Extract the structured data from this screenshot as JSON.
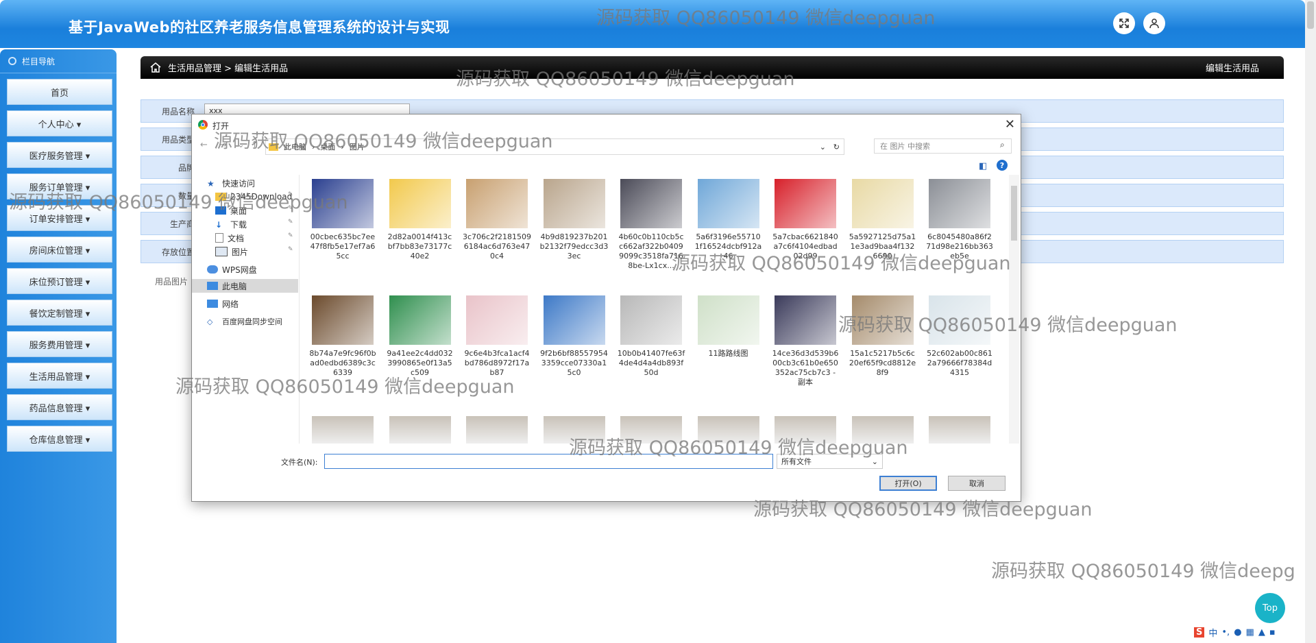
{
  "header": {
    "title": "基于JavaWeb的社区养老服务信息管理系统的设计与实现"
  },
  "sidebar": {
    "nav_title": "栏目导航",
    "items": [
      {
        "label": "首页"
      },
      {
        "label": "个人中心 ▾"
      },
      {
        "label": "医疗服务管理 ▾"
      },
      {
        "label": "服务订单管理 ▾"
      },
      {
        "label": "订单安排管理 ▾"
      },
      {
        "label": "房间床位管理 ▾"
      },
      {
        "label": "床位预订管理 ▾"
      },
      {
        "label": "餐饮定制管理 ▾"
      },
      {
        "label": "服务费用管理 ▾"
      },
      {
        "label": "生活用品管理 ▾"
      },
      {
        "label": "药品信息管理 ▾"
      },
      {
        "label": "仓库信息管理 ▾"
      }
    ]
  },
  "breadcrumb": {
    "path": "生活用品管理 > 编辑生活用品",
    "right": "编辑生活用品"
  },
  "form": {
    "rows": [
      {
        "label": "用品名称",
        "value": "xxx"
      },
      {
        "label": "用品类型",
        "value": ""
      },
      {
        "label": "品牌",
        "value": ""
      },
      {
        "label": "数量",
        "value": ""
      },
      {
        "label": "生产商",
        "value": ""
      },
      {
        "label": "存放位置",
        "value": ""
      }
    ],
    "picture_label": "用品图片"
  },
  "dialog": {
    "title": "打开",
    "address": [
      "此电脑",
      "桌面",
      "图片"
    ],
    "search_placeholder": "在 图片 中搜索",
    "nav": [
      {
        "label": "快速访问"
      },
      {
        "label": "2345Download"
      },
      {
        "label": "桌面"
      },
      {
        "label": "下载"
      },
      {
        "label": "文档"
      },
      {
        "label": "图片"
      },
      {
        "label": "WPS网盘"
      },
      {
        "label": "此电脑"
      },
      {
        "label": "网络"
      },
      {
        "label": "百度网盘同步空间"
      }
    ],
    "files": [
      {
        "name": "00cbec635bc7ee47f8fb5e17ef7a65cc",
        "color": "#2a3f8f"
      },
      {
        "name": "2d82a0014f413cbf7bb83e73177c40e2",
        "color": "#f2c94c"
      },
      {
        "name": "3c706c2f21815096184ac6d763e470c4",
        "color": "#c8a070"
      },
      {
        "name": "4b9d819237b201b2132f79edcc3d33ec",
        "color": "#b9a58c"
      },
      {
        "name": "4b60c0b110cb5cc662af322b04099099c3518fa7168be-Lx1cx...",
        "color": "#4b4b58"
      },
      {
        "name": "5a6f3196e557101f16524dcbf912a46",
        "color": "#6fa7d8"
      },
      {
        "name": "5a7cbac6621840a7c6f4104edbad02d99",
        "color": "#d7202a"
      },
      {
        "name": "5a5927125d75a11e3ad9baa4f1326690",
        "color": "#e8d9a4"
      },
      {
        "name": "6c8045480a86f271d98e216bb363eb5e",
        "color": "#8b8f96"
      },
      {
        "name": "8b74a7e9fc96f0bad0edbd6389c3c6339",
        "color": "#6b4a2c"
      },
      {
        "name": "9a41ee2c4dd0323990865e0f13a5c509",
        "color": "#2f8f4e"
      },
      {
        "name": "9c6e4b3fca1acf4bd786d8972f17ab87",
        "color": "#e9c3c9"
      },
      {
        "name": "9f2b6bf885579543359cce07330a15c0",
        "color": "#3d79c7"
      },
      {
        "name": "10b0b41407fe63f4de4d4a4db893f50d",
        "color": "#b8b8b8"
      },
      {
        "name": "11路路线图",
        "color": "#cfe0c8"
      },
      {
        "name": "14ce36d3d539b600cb3c61b0e650352ac75cb7c3 - 副本",
        "color": "#3a3a5a"
      },
      {
        "name": "15a1c5217b5c6c20ef65f9cd8812e8f9",
        "color": "#a58b6b"
      },
      {
        "name": "52c602ab00c8612a79666f78384d4315",
        "color": "#d9e4ea"
      }
    ],
    "filename_label": "文件名(N):",
    "filename_value": "",
    "filetype": "所有文件",
    "open_button": "打开(O)",
    "cancel_button": "取消"
  },
  "watermark": "源码获取 QQ86050149 微信deepguan",
  "watermark_last": "源码获取 QQ86050149 微信deepg",
  "top_button": "Top",
  "ime": "中"
}
